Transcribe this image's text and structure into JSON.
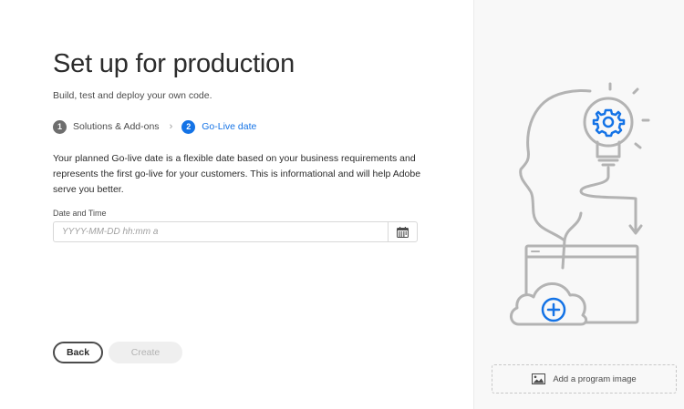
{
  "page": {
    "title": "Set up for production",
    "subtitle": "Build, test and deploy your own code."
  },
  "stepper": {
    "steps": [
      {
        "number": "1",
        "label": "Solutions & Add-ons",
        "state": "done"
      },
      {
        "number": "2",
        "label": "Go-Live date",
        "state": "active"
      }
    ],
    "separator_icon": "chevron-right-icon"
  },
  "description": "Your planned Go-live date is a flexible date based on your business requirements and represents the first go-live for your customers. This is informational and will help Adobe serve you better.",
  "date_field": {
    "label": "Date and Time",
    "placeholder": "YYYY-MM-DD hh:mm a",
    "value": "",
    "icon": "calendar-icon"
  },
  "actions": {
    "back_label": "Back",
    "create_label": "Create"
  },
  "side_panel": {
    "illustration": "head-lightbulb-gear-cloud-illustration",
    "add_image_label": "Add a program image",
    "add_image_icon": "image-icon"
  },
  "colors": {
    "accent": "#1473e6",
    "step_done": "#6e6e6e",
    "illustration_stroke": "#b3b3b3"
  }
}
